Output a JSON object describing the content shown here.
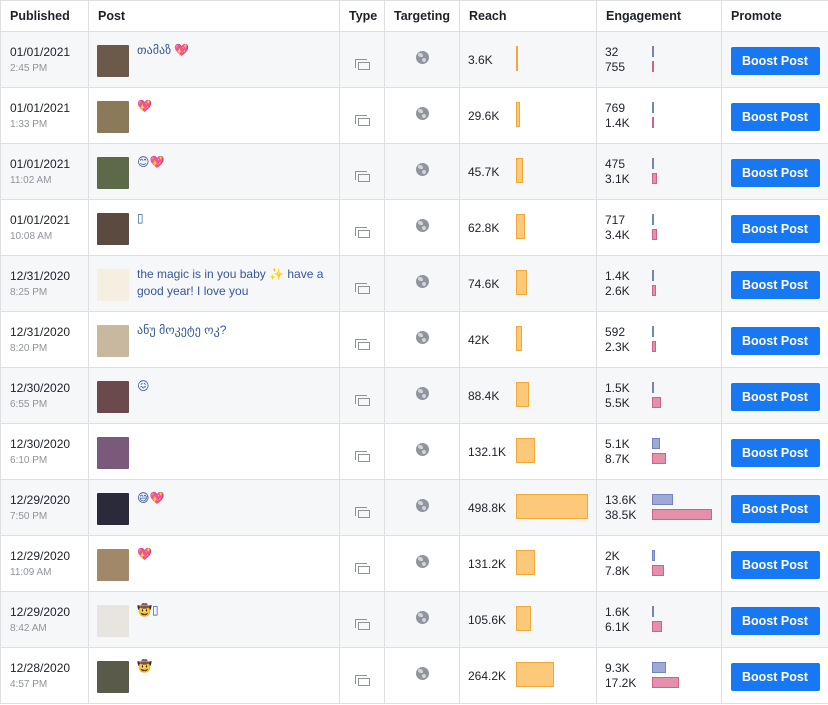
{
  "headers": {
    "published": "Published",
    "post": "Post",
    "type": "Type",
    "targeting": "Targeting",
    "reach": "Reach",
    "engagement": "Engagement",
    "promote": "Promote"
  },
  "colors": {
    "reach_bar": "#fcc97a",
    "engagement_bar_1": "#9fa9d6",
    "engagement_bar_2": "#e590ab",
    "boost_button": "#1877f2"
  },
  "icons": {
    "type": "post-type-icon",
    "targeting": "globe-icon"
  },
  "rows": [
    {
      "date": "01/01/2021",
      "time": "2:45 PM",
      "text": "თამაზ 💖",
      "reach_label": "3.6K",
      "reach": 3600,
      "eng1_label": "32",
      "eng1": 32,
      "eng2_label": "755",
      "eng2": 755,
      "button": "Boost Post"
    },
    {
      "date": "01/01/2021",
      "time": "1:33 PM",
      "text": "💖",
      "reach_label": "29.6K",
      "reach": 29600,
      "eng1_label": "769",
      "eng1": 769,
      "eng2_label": "1.4K",
      "eng2": 1400,
      "button": "Boost Post"
    },
    {
      "date": "01/01/2021",
      "time": "11:02 AM",
      "text": "😊💖",
      "reach_label": "45.7K",
      "reach": 45700,
      "eng1_label": "475",
      "eng1": 475,
      "eng2_label": "3.1K",
      "eng2": 3100,
      "button": "Boost Post"
    },
    {
      "date": "01/01/2021",
      "time": "10:08 AM",
      "text": "▯",
      "reach_label": "62.8K",
      "reach": 62800,
      "eng1_label": "717",
      "eng1": 717,
      "eng2_label": "3.4K",
      "eng2": 3400,
      "button": "Boost Post"
    },
    {
      "date": "12/31/2020",
      "time": "8:25 PM",
      "text": "the magic is in you baby ✨ have a good year! I love you",
      "reach_label": "74.6K",
      "reach": 74600,
      "eng1_label": "1.4K",
      "eng1": 1400,
      "eng2_label": "2.6K",
      "eng2": 2600,
      "button": "Boost Post"
    },
    {
      "date": "12/31/2020",
      "time": "8:20 PM",
      "text": "ანუ მოკეტე ოკ?",
      "reach_label": "42K",
      "reach": 42000,
      "eng1_label": "592",
      "eng1": 592,
      "eng2_label": "2.3K",
      "eng2": 2300,
      "button": "Boost Post"
    },
    {
      "date": "12/30/2020",
      "time": "6:55 PM",
      "text": "😖",
      "reach_label": "88.4K",
      "reach": 88400,
      "eng1_label": "1.5K",
      "eng1": 1500,
      "eng2_label": "5.5K",
      "eng2": 5500,
      "button": "Boost Post"
    },
    {
      "date": "12/30/2020",
      "time": "6:10 PM",
      "text": "",
      "reach_label": "132.1K",
      "reach": 132100,
      "eng1_label": "5.1K",
      "eng1": 5100,
      "eng2_label": "8.7K",
      "eng2": 8700,
      "button": "Boost Post"
    },
    {
      "date": "12/29/2020",
      "time": "7:50 PM",
      "text": "😅💖",
      "reach_label": "498.8K",
      "reach": 498800,
      "eng1_label": "13.6K",
      "eng1": 13600,
      "eng2_label": "38.5K",
      "eng2": 38500,
      "button": "Boost Post"
    },
    {
      "date": "12/29/2020",
      "time": "11:09 AM",
      "text": "💖",
      "reach_label": "131.2K",
      "reach": 131200,
      "eng1_label": "2K",
      "eng1": 2000,
      "eng2_label": "7.8K",
      "eng2": 7800,
      "button": "Boost Post"
    },
    {
      "date": "12/29/2020",
      "time": "8:42 AM",
      "text": "🤠▯",
      "reach_label": "105.6K",
      "reach": 105600,
      "eng1_label": "1.6K",
      "eng1": 1600,
      "eng2_label": "6.1K",
      "eng2": 6100,
      "button": "Boost Post"
    },
    {
      "date": "12/28/2020",
      "time": "4:57 PM",
      "text": "🤠",
      "reach_label": "264.2K",
      "reach": 264200,
      "eng1_label": "9.3K",
      "eng1": 9300,
      "eng2_label": "17.2K",
      "eng2": 17200,
      "button": "Boost Post"
    }
  ]
}
